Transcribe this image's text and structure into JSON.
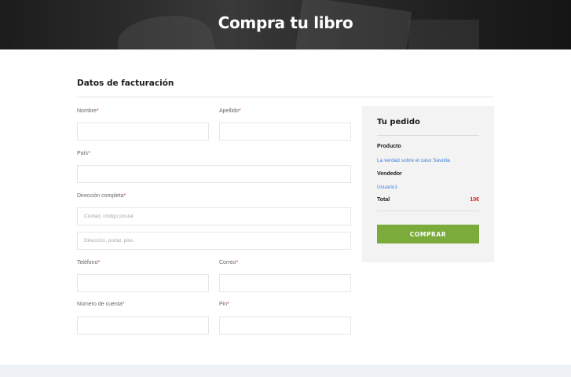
{
  "hero": {
    "title": "Compra tu libro"
  },
  "billing": {
    "title": "Datos de facturación",
    "required_mark": "*",
    "nombre_label": "Nombre",
    "apellido_label": "Apellido",
    "pais_label": "País",
    "direccion_label": "Dirección completa",
    "direccion_placeholder1": "Ciudad, código postal",
    "direccion_placeholder2": "Dirección, portal, piso",
    "telefono_label": "Teléfono",
    "correo_label": "Correo",
    "cuenta_label": "Número de cuenta",
    "pin_label": "Pin"
  },
  "order": {
    "title": "Tu pedido",
    "product_label": "Producto",
    "product_value": "La verdad sobre el caso Savolta",
    "seller_label": "Vendedor",
    "seller_value": "Usuario1",
    "total_label": "Total",
    "total_value": "10€",
    "buy_button": "COMPRAR"
  },
  "colors": {
    "accent_green": "#7aab3b",
    "link_blue": "#3b7fd9",
    "price_red": "#d81e1e",
    "required_red": "#d0342c"
  }
}
